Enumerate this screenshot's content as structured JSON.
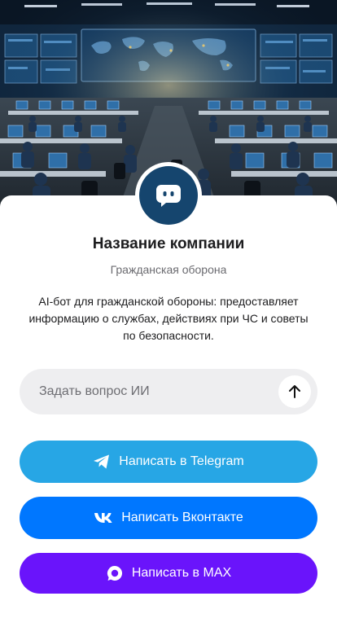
{
  "hero": {
    "image": "control-room-illustration"
  },
  "profile": {
    "company_name": "Название компании",
    "category": "Гражданская оборона",
    "description": "AI-бот для гражданской обороны: предоставляет информацию о службах, действиях при ЧС и советы по безопасности.",
    "avatar_icon": "chat-bot-icon",
    "avatar_color": "#15456e"
  },
  "ask": {
    "placeholder": "Задать вопрос ИИ",
    "value": "",
    "send_icon": "arrow-up-icon"
  },
  "buttons": {
    "telegram": {
      "label": "Написать в Telegram",
      "icon": "telegram-icon",
      "color": "#27a6e5"
    },
    "vk": {
      "label": "Написать Вконтакте",
      "icon": "vk-icon",
      "color": "#0077ff"
    },
    "max": {
      "label": "Написать в MAX",
      "icon": "max-icon",
      "color": "#6a14fb"
    }
  }
}
